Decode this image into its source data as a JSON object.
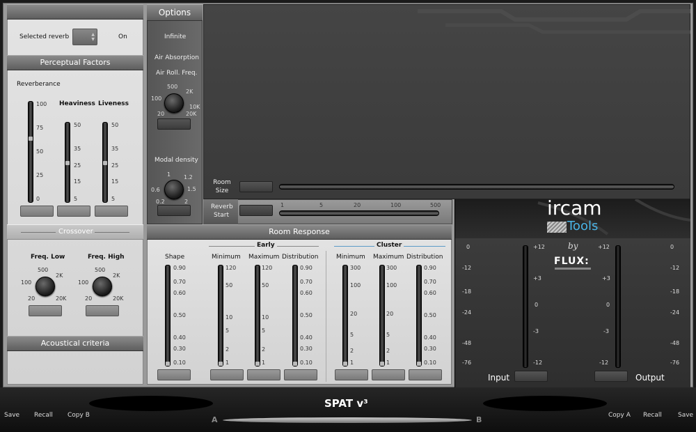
{
  "left": {
    "selected_reverb_label": "Selected reverb",
    "on_label": "On",
    "perceptual_header": "Perceptual Factors",
    "reverberance_label": "Reverberance",
    "heaviness_label": "Heaviness",
    "liveness_label": "Liveness",
    "reverb_ticks": [
      "100",
      "75",
      "50",
      "25",
      "0"
    ],
    "heavy_ticks": [
      "50",
      "35",
      "25",
      "15",
      "5"
    ],
    "live_ticks": [
      "50",
      "35",
      "25",
      "15",
      "5"
    ],
    "crossover_header": "Crossover",
    "freq_low_label": "Freq. Low",
    "freq_high_label": "Freq. High",
    "knob_ticks": [
      "500",
      "2K",
      "100",
      "20",
      "20K"
    ],
    "acoustical_header": "Acoustical criteria"
  },
  "options": {
    "header": "Options",
    "infinite_label": "Infinite",
    "air_absorption_label": "Air Absorption",
    "air_roll_label": "Air Roll. Freq.",
    "air_ticks": [
      "500",
      "2K",
      "100",
      "10K",
      "20",
      "20K"
    ],
    "modal_density_label": "Modal density",
    "modal_ticks": [
      "1",
      "1.2",
      "0.6",
      "1.5",
      "0.2",
      "2"
    ]
  },
  "room": {
    "room_size_label_1": "Room",
    "room_size_label_2": "Size",
    "reverb_start_label_1": "Reverb",
    "reverb_start_label_2": "Start",
    "reverb_start_ticks": [
      "1",
      "5",
      "20",
      "100",
      "500"
    ]
  },
  "response": {
    "header": "Room Response",
    "early_label": "Early",
    "cluster_label": "Cluster",
    "shape_label": "Shape",
    "minimum_label": "Minimum",
    "maximum_label": "Maximum",
    "distribution_label": "Distribution",
    "shape_ticks": [
      "0.90",
      "0.70",
      "0.60",
      "0.50",
      "0.40",
      "0.30",
      "0.10"
    ],
    "early_min_ticks": [
      "120",
      "50",
      "10",
      "5",
      "2",
      "1"
    ],
    "cluster_min_ticks": [
      "300",
      "100",
      "20",
      "5",
      "2",
      "1"
    ]
  },
  "meters": {
    "brand_ircam": "ircam",
    "brand_tools": "Tools",
    "by_label": "by",
    "flux_label": "FLUX:",
    "outer_ticks": [
      "0",
      "-12",
      "-18",
      "-24",
      "-48",
      "-76"
    ],
    "inner_ticks": [
      "+12",
      "+3",
      "0",
      "-3",
      "-12"
    ],
    "input_label": "Input",
    "output_label": "Output"
  },
  "footer": {
    "save_left": "Save",
    "recall_left": "Recall",
    "copy_b": "Copy B",
    "title": "SPAT v³",
    "a_label": "A",
    "b_label": "B",
    "copy_a": "Copy A",
    "recall_right": "Recall",
    "save_right": "Save"
  }
}
